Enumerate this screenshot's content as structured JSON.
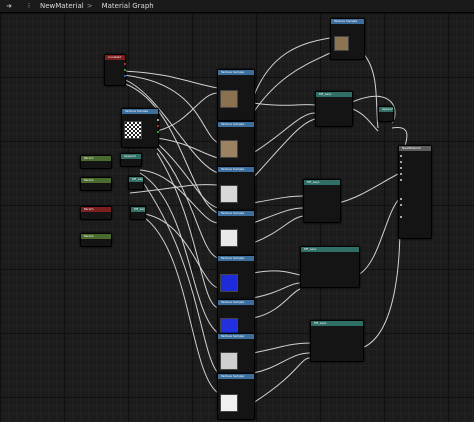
{
  "topbar": {
    "back_icon": "arrow-right-icon",
    "graph_icon": "graph-icon",
    "crumbs": [
      "NewMaterial",
      "Material Graph"
    ]
  },
  "nodes": {
    "constant": "Constant",
    "tex_top": "Texture Sample",
    "tex_a": "Texture Sample",
    "tex_b": "Texture Sample",
    "tex_c": "Texture Sample",
    "tex_d": "Texture Sample",
    "tex_e": "Texture Sample",
    "tex_f": "Texture Sample",
    "tex_g": "Texture Sample",
    "tex_noise": "Texture Sample",
    "lerp1": "MF_Lerp",
    "lerp2": "MF_Lerp",
    "lerp3": "MF_Lerp",
    "lerp4": "MF_Lerp",
    "append": "Append",
    "param1": "Param",
    "param2": "Param",
    "param3": "Param",
    "param4": "Param",
    "material": "NewMaterial"
  },
  "colors": {
    "texture_header": "#3c6f9e",
    "param_header": "#4a6b2e",
    "constant_header": "#7a1e1e",
    "function_header": "#2f6f66",
    "material_header": "#5c5c5c",
    "wire": "#e6e6e6"
  }
}
